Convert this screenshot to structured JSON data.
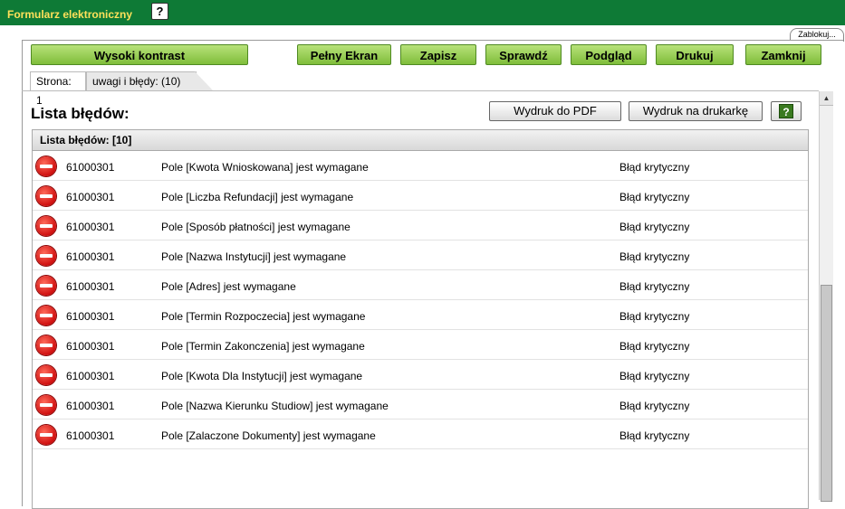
{
  "window": {
    "title": "Formularz elektroniczny",
    "help_label": "?"
  },
  "lock_tab": {
    "label": "Zablokuj..."
  },
  "toolbar": {
    "contrast_label": "Wysoki kontrast",
    "fullscreen_label": "Pełny Ekran",
    "save_label": "Zapisz",
    "check_label": "Sprawdź",
    "preview_label": "Podgląd",
    "print_label": "Drukuj",
    "close_label": "Zamknij"
  },
  "tabs": {
    "page_label": "Strona: 1",
    "errors_label": "uwagi i błędy: (10)"
  },
  "main": {
    "heading": "Lista błędów:",
    "pdf_label": "Wydruk do PDF",
    "printer_label": "Wydruk na drukarkę",
    "help_label": "?"
  },
  "list": {
    "header": "Lista błędów: [10]",
    "rows": [
      {
        "code": "61000301",
        "message": "Pole [Kwota Wnioskowana] jest wymagane",
        "severity": "Błąd krytyczny"
      },
      {
        "code": "61000301",
        "message": "Pole [Liczba Refundacji] jest wymagane",
        "severity": "Błąd krytyczny"
      },
      {
        "code": "61000301",
        "message": "Pole [Sposób płatności] jest wymagane",
        "severity": "Błąd krytyczny"
      },
      {
        "code": "61000301",
        "message": "Pole [Nazwa Instytucji] jest wymagane",
        "severity": "Błąd krytyczny"
      },
      {
        "code": "61000301",
        "message": "Pole [Adres] jest wymagane",
        "severity": "Błąd krytyczny"
      },
      {
        "code": "61000301",
        "message": "Pole [Termin Rozpoczecia] jest wymagane",
        "severity": "Błąd krytyczny"
      },
      {
        "code": "61000301",
        "message": "Pole [Termin Zakonczenia] jest wymagane",
        "severity": "Błąd krytyczny"
      },
      {
        "code": "61000301",
        "message": "Pole [Kwota Dla Instytucji] jest wymagane",
        "severity": "Błąd krytyczny"
      },
      {
        "code": "61000301",
        "message": "Pole [Nazwa Kierunku Studiow] jest wymagane",
        "severity": "Błąd krytyczny"
      },
      {
        "code": "61000301",
        "message": "Pole [Zalaczone Dokumenty] jest wymagane",
        "severity": "Błąd krytyczny"
      }
    ]
  },
  "colors": {
    "titlebar": "#0e7a36",
    "title_text": "#ffe15a",
    "button_green": "#8ec94a",
    "error_icon": "#d01010"
  },
  "icons": {
    "row_icon": "error-stop-icon",
    "scroll_up": "arrow-up-icon"
  }
}
